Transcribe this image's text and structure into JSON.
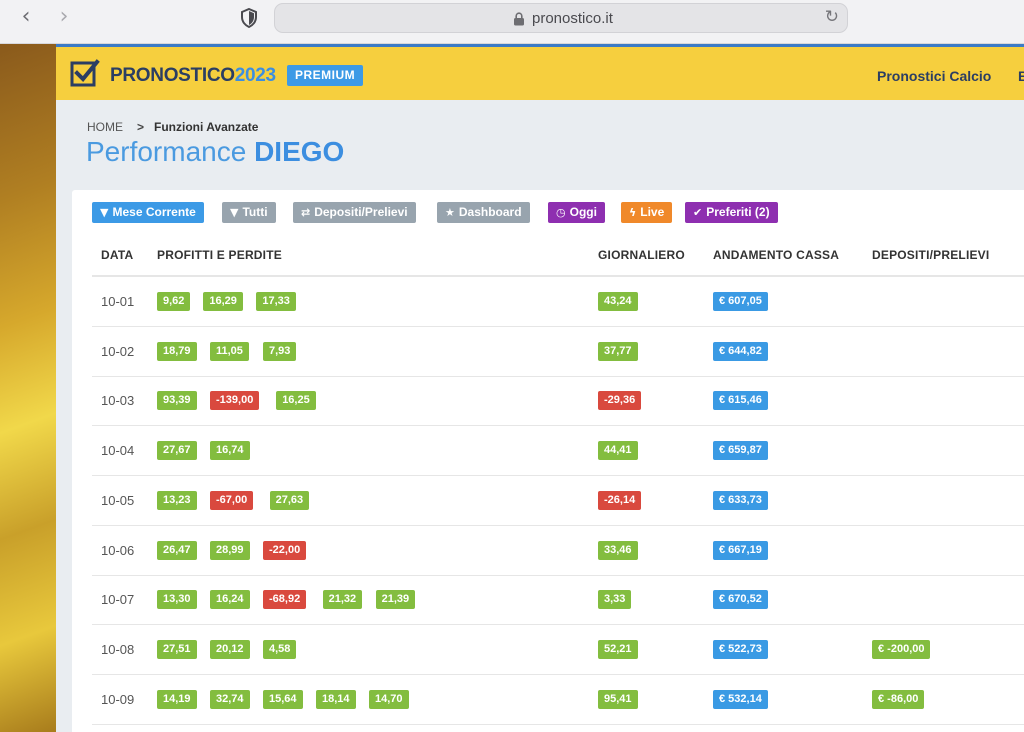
{
  "browser": {
    "url": "pronostico.it"
  },
  "header": {
    "logo_main": "PRONOSTICO",
    "logo_year": "2023",
    "premium_label": "PREMIUM",
    "nav_items": [
      "Pronostici Calcio",
      "B"
    ]
  },
  "breadcrumb": {
    "home": "HOME",
    "separator": ">",
    "current": "Funzioni Avanzate"
  },
  "page": {
    "title_prefix": "Performance",
    "title_name": "DIEGO"
  },
  "filters": [
    {
      "label": "Mese Corrente",
      "icon": "filter-icon",
      "glyph": "▼",
      "color": "#3c9ae6"
    },
    {
      "label": "Tutti",
      "icon": "filter-icon",
      "glyph": "▼",
      "color": "#98a4ae"
    },
    {
      "label": "Depositi/Prelievi",
      "icon": "exchange-icon",
      "glyph": "⇄",
      "color": "#98a4ae"
    },
    {
      "label": "Dashboard",
      "icon": "star-icon",
      "glyph": "★",
      "color": "#98a4ae"
    },
    {
      "label": "Oggi",
      "icon": "clock-icon",
      "glyph": "◷",
      "color": "#8e2fb0"
    },
    {
      "label": "Live",
      "icon": "bolt-icon",
      "glyph": "ϟ",
      "color": "#f0892a"
    },
    {
      "label": "Preferiti (2)",
      "icon": "check-icon",
      "glyph": "✔",
      "color": "#8e2fb0"
    }
  ],
  "table": {
    "headers": [
      "DATA",
      "PROFITTI E PERDITE",
      "GIORNALIERO",
      "ANDAMENTO CASSA",
      "DEPOSITI/PRELIEVI"
    ],
    "rows": [
      {
        "date": "10-01",
        "pl": [
          "9,62",
          "16,29",
          "17,33"
        ],
        "daily": "43,24",
        "cash": "€ 607,05",
        "dep": ""
      },
      {
        "date": "10-02",
        "pl": [
          "18,79",
          "11,05",
          "7,93"
        ],
        "daily": "37,77",
        "cash": "€ 644,82",
        "dep": ""
      },
      {
        "date": "10-03",
        "pl": [
          "93,39",
          "-139,00",
          "16,25"
        ],
        "daily": "-29,36",
        "cash": "€ 615,46",
        "dep": ""
      },
      {
        "date": "10-04",
        "pl": [
          "27,67",
          "16,74"
        ],
        "daily": "44,41",
        "cash": "€ 659,87",
        "dep": ""
      },
      {
        "date": "10-05",
        "pl": [
          "13,23",
          "-67,00",
          "27,63"
        ],
        "daily": "-26,14",
        "cash": "€ 633,73",
        "dep": ""
      },
      {
        "date": "10-06",
        "pl": [
          "26,47",
          "28,99",
          "-22,00"
        ],
        "daily": "33,46",
        "cash": "€ 667,19",
        "dep": ""
      },
      {
        "date": "10-07",
        "pl": [
          "13,30",
          "16,24",
          "-68,92",
          "21,32",
          "21,39"
        ],
        "daily": "3,33",
        "cash": "€ 670,52",
        "dep": ""
      },
      {
        "date": "10-08",
        "pl": [
          "27,51",
          "20,12",
          "4,58"
        ],
        "daily": "52,21",
        "cash": "€ 522,73",
        "dep": "€ -200,00"
      },
      {
        "date": "10-09",
        "pl": [
          "14,19",
          "32,74",
          "15,64",
          "18,14",
          "14,70"
        ],
        "daily": "95,41",
        "cash": "€ 532,14",
        "dep": "€ -86,00"
      }
    ]
  },
  "colors": {
    "positive": "#83bd3f",
    "negative": "#d9493e",
    "cash": "#3a9ae4",
    "header_bg": "#f6cf3e",
    "accent": "#3c8ee0"
  }
}
